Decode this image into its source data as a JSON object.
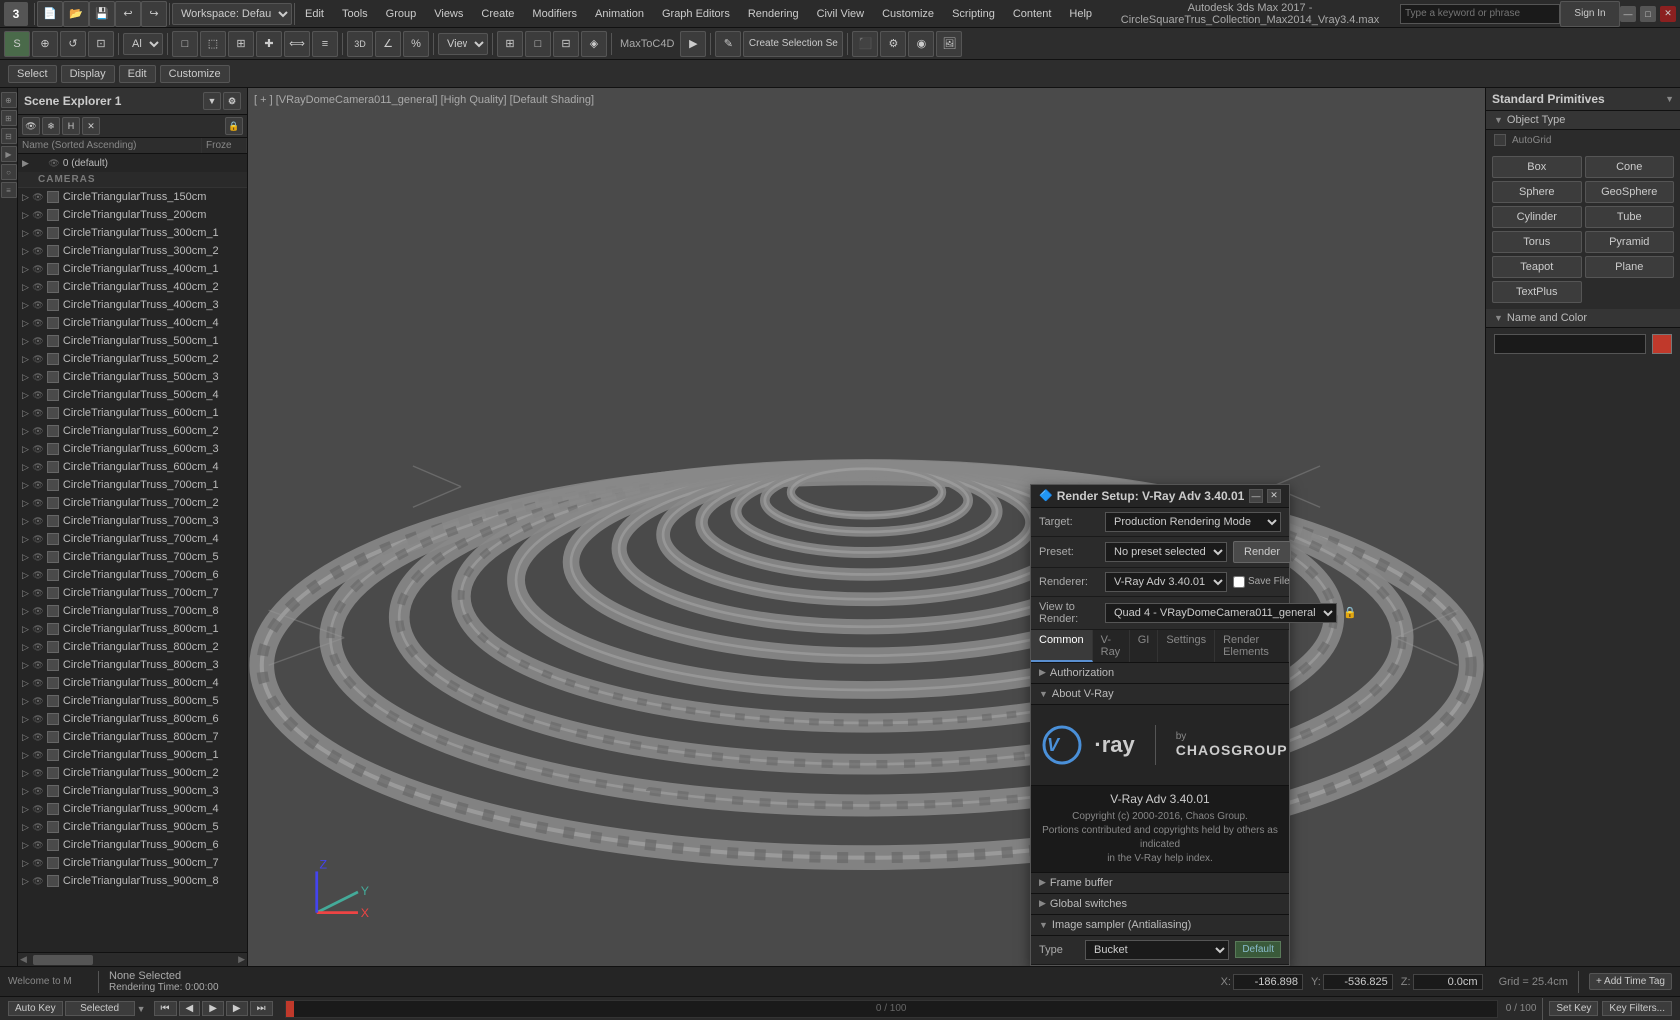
{
  "window": {
    "title": "Autodesk 3ds Max 2017 - CircleSquareTrus_Collection_Max2014_Vray3.4.max",
    "app_version": "3",
    "search_placeholder": "Type a keyword or phrase",
    "sign_in": "Sign In"
  },
  "menu": {
    "items": [
      "Edit",
      "Tools",
      "Group",
      "Views",
      "Create",
      "Modifiers",
      "Animation",
      "Graph Editors",
      "Rendering",
      "Civil View",
      "Customize",
      "Scripting",
      "Content",
      "Help"
    ]
  },
  "toolbar": {
    "workspace": "Workspace: Default",
    "selection_mode": "All",
    "view_label": "View",
    "maxtoc4d": "MaxToC4D",
    "create_selection": "Create Selection Se"
  },
  "viewport": {
    "label": "[ + ] [VRayDomeCamera011_general] [High Quality] [Default Shading]"
  },
  "scene_explorer": {
    "title": "Scene Explorer 1",
    "columns": [
      "Name (Sorted Ascending)",
      "Froze"
    ],
    "default_item": "0 (default)",
    "cameras_label": "CAMERAS",
    "items": [
      "CircleTriangularTruss_150cm",
      "CircleTriangularTruss_200cm",
      "CircleTriangularTruss_300cm_1",
      "CircleTriangularTruss_300cm_2",
      "CircleTriangularTruss_400cm_1",
      "CircleTriangularTruss_400cm_2",
      "CircleTriangularTruss_400cm_3",
      "CircleTriangularTruss_400cm_4",
      "CircleTriangularTruss_500cm_1",
      "CircleTriangularTruss_500cm_2",
      "CircleTriangularTruss_500cm_3",
      "CircleTriangularTruss_500cm_4",
      "CircleTriangularTruss_600cm_1",
      "CircleTriangularTruss_600cm_2",
      "CircleTriangularTruss_600cm_3",
      "CircleTriangularTruss_600cm_4",
      "CircleTriangularTruss_700cm_1",
      "CircleTriangularTruss_700cm_2",
      "CircleTriangularTruss_700cm_3",
      "CircleTriangularTruss_700cm_4",
      "CircleTriangularTruss_700cm_5",
      "CircleTriangularTruss_700cm_6",
      "CircleTriangularTruss_700cm_7",
      "CircleTriangularTruss_700cm_8",
      "CircleTriangularTruss_800cm_1",
      "CircleTriangularTruss_800cm_2",
      "CircleTriangularTruss_800cm_3",
      "CircleTriangularTruss_800cm_4",
      "CircleTriangularTruss_800cm_5",
      "CircleTriangularTruss_800cm_6",
      "CircleTriangularTruss_800cm_7",
      "CircleTriangularTruss_900cm_1",
      "CircleTriangularTruss_900cm_2",
      "CircleTriangularTruss_900cm_3",
      "CircleTriangularTruss_900cm_4",
      "CircleTriangularTruss_900cm_5",
      "CircleTriangularTruss_900cm_6",
      "CircleTriangularTruss_900cm_7",
      "CircleTriangularTruss_900cm_8"
    ]
  },
  "right_panel": {
    "category": "Standard Primitives",
    "sections": {
      "object_type": "Object Type",
      "name_and_color": "Name and Color"
    },
    "autogrid": "AutoGrid",
    "objects": [
      "Box",
      "Cone",
      "Sphere",
      "GeoSphere",
      "Cylinder",
      "Tube",
      "Torus",
      "Pyramid",
      "Teapot",
      "Plane",
      "TextPlus"
    ]
  },
  "render_setup": {
    "title": "Render Setup: V-Ray Adv 3.40.01",
    "target_label": "Target:",
    "target_value": "Production Rendering Mode",
    "preset_label": "Preset:",
    "preset_value": "No preset selected",
    "renderer_label": "Renderer:",
    "renderer_value": "V-Ray Adv 3.40.01",
    "save_file_label": "Save File",
    "view_to_render_label": "View to Render:",
    "view_to_render_value": "Quad 4 - VRayDomeCamera011_general",
    "render_button": "Render",
    "tabs": [
      "Common",
      "V-Ray",
      "GI",
      "Settings",
      "Render Elements"
    ],
    "sections": [
      "Authorization",
      "About V-Ray",
      "Frame buffer",
      "Global switches",
      "Image sampler (Antialiasing)"
    ],
    "vray_version": "V-Ray Adv 3.40.01",
    "vray_copyright": "Copyright (c) 2000-2016, Chaos Group.",
    "vray_contrib": "Portions contributed and copyrights held by others as indicated",
    "vray_help": "in the V-Ray help index.",
    "type_label": "Type",
    "type_value": "Bucket",
    "default_label": "Default",
    "active_tab": "Common"
  },
  "status_bar": {
    "select_label": "Select",
    "display_label": "Display",
    "edit_label": "Edit",
    "customize_label": "Customize",
    "none_selected": "None Selected",
    "rendering_time": "Rendering Time: 0:00:00",
    "welcome": "Welcome to M",
    "coords": {
      "x_label": "X:",
      "x_value": "-186.898",
      "y_label": "Y:",
      "y_value": "-536.825",
      "z_label": "Z:",
      "z_value": "0.0cm"
    },
    "grid": "Grid = 25.4cm",
    "timeline": "0 / 100",
    "auto_key": "Auto Key",
    "selected": "Selected",
    "set_key": "Set Key",
    "key_filters": "Key Filters..."
  }
}
